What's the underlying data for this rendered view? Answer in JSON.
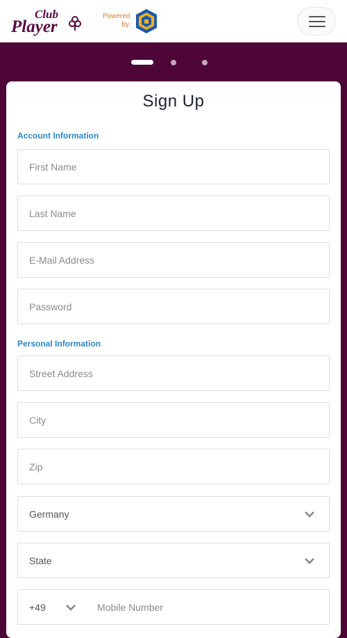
{
  "header": {
    "logo_text_top": "Club",
    "logo_text_bottom": "Player",
    "powered_line1": "Powered",
    "powered_line2": "by"
  },
  "carousel": {
    "total": 3,
    "active": 1
  },
  "form": {
    "title": "Sign Up",
    "account_section": "Account Information",
    "personal_section": "Personal Information",
    "first_name_placeholder": "First Name",
    "last_name_placeholder": "Last Name",
    "email_placeholder": "E-Mail Address",
    "password_placeholder": "Password",
    "street_placeholder": "Street Address",
    "city_placeholder": "City",
    "zip_placeholder": "Zip",
    "country_value": "Germany",
    "state_value": "State",
    "phone_code": "+49",
    "mobile_placeholder": "Mobile Number"
  },
  "colors": {
    "brand_background": "#4e0637",
    "section_label": "#2a86c9",
    "powered_text": "#e07a2a"
  }
}
